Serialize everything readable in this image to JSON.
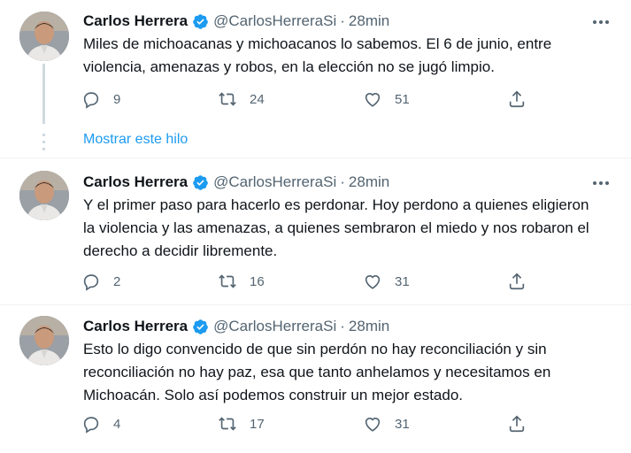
{
  "tweets": [
    {
      "name": "Carlos Herrera",
      "handle": "@CarlosHerreraSi",
      "separator": "·",
      "time": "28min",
      "text": "Miles de michoacanas y michoacanos lo sabemos. El 6 de junio, entre\nviolencia, amenazas y robos, en la elección no se jugó limpio.",
      "replies": "9",
      "retweets": "24",
      "likes": "51"
    },
    {
      "name": "Carlos Herrera",
      "handle": "@CarlosHerreraSi",
      "separator": "·",
      "time": "28min",
      "text": "Y el primer paso para hacerlo es perdonar. Hoy perdono a quienes eligieron\nla violencia y las amenazas, a quienes sembraron el miedo y nos robaron el\nderecho a decidir libremente.",
      "replies": "2",
      "retweets": "16",
      "likes": "31"
    },
    {
      "name": "Carlos Herrera",
      "handle": "@CarlosHerreraSi",
      "separator": "·",
      "time": "28min",
      "text": "Esto lo digo convencido de que sin perdón no hay reconciliación y sin\nreconciliación no hay paz, esa que tanto anhelamos y necesitamos en\nMichoacán. Solo así podemos construir un mejor estado.",
      "replies": "4",
      "retweets": "17",
      "likes": "31"
    }
  ],
  "show_thread": "Mostrar este hilo",
  "colors": {
    "verified": "#1d9bf0",
    "link": "#1d9bf0",
    "muted": "#536471",
    "text": "#0f1419"
  }
}
